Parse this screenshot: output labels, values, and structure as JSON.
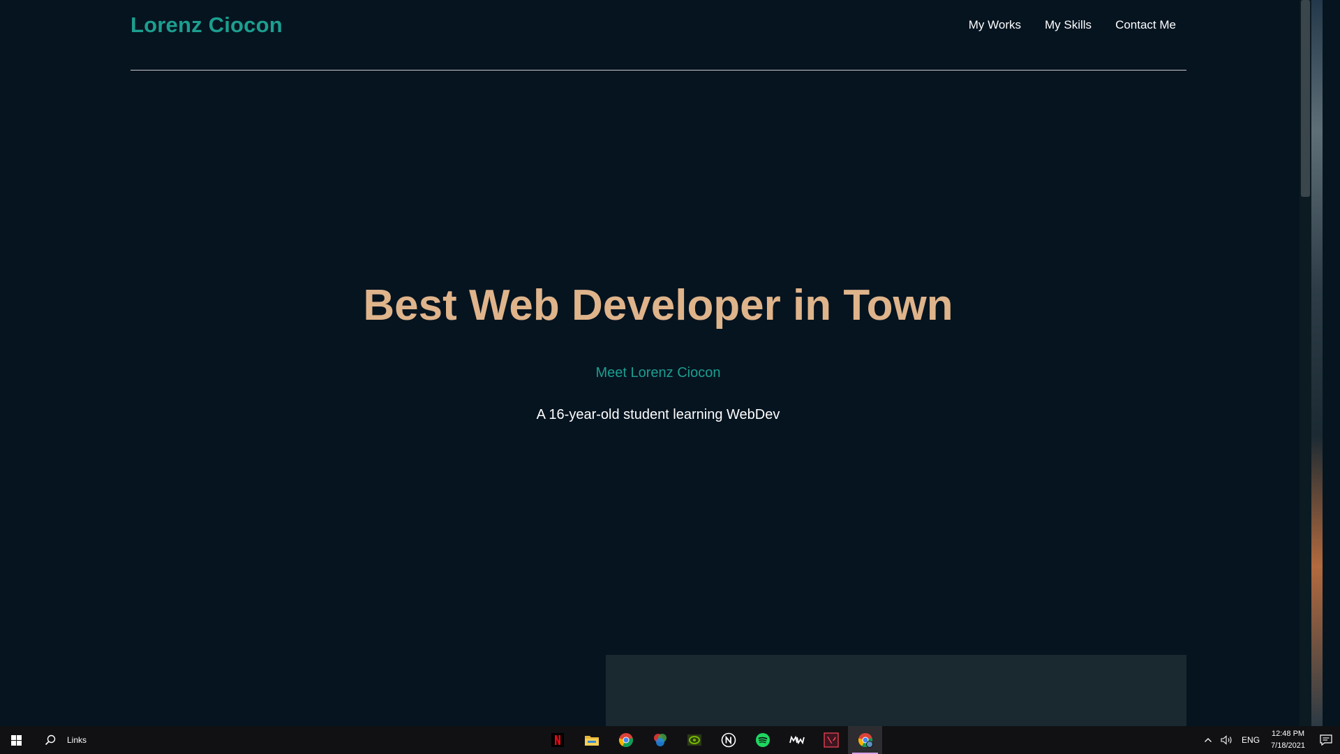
{
  "site": {
    "brand": "Lorenz Ciocon",
    "nav": [
      {
        "label": "My Works"
      },
      {
        "label": "My Skills"
      },
      {
        "label": "Contact Me"
      }
    ]
  },
  "hero": {
    "title": "Best Web Developer in Town",
    "subtitle": "Meet Lorenz Ciocon",
    "description": "A 16-year-old student learning WebDev"
  },
  "colors": {
    "background": "#061420",
    "accent_teal": "#1c9e8f",
    "title_tan": "#dfb48b",
    "panel": "#1a2830"
  },
  "taskbar": {
    "search_label": "Links",
    "pinned_apps": [
      {
        "icon": "netflix-icon"
      },
      {
        "icon": "file-explorer-icon"
      },
      {
        "icon": "chrome-icon"
      },
      {
        "icon": "color-wheel-icon"
      },
      {
        "icon": "nvidia-icon"
      },
      {
        "icon": "notion-icon"
      },
      {
        "icon": "spotify-icon"
      },
      {
        "icon": "mw-app-icon"
      },
      {
        "icon": "valorant-icon"
      },
      {
        "icon": "chrome-profile-icon",
        "active": true
      }
    ],
    "tray": {
      "language": "ENG",
      "time": "12:48 PM",
      "date": "7/18/2021"
    }
  }
}
